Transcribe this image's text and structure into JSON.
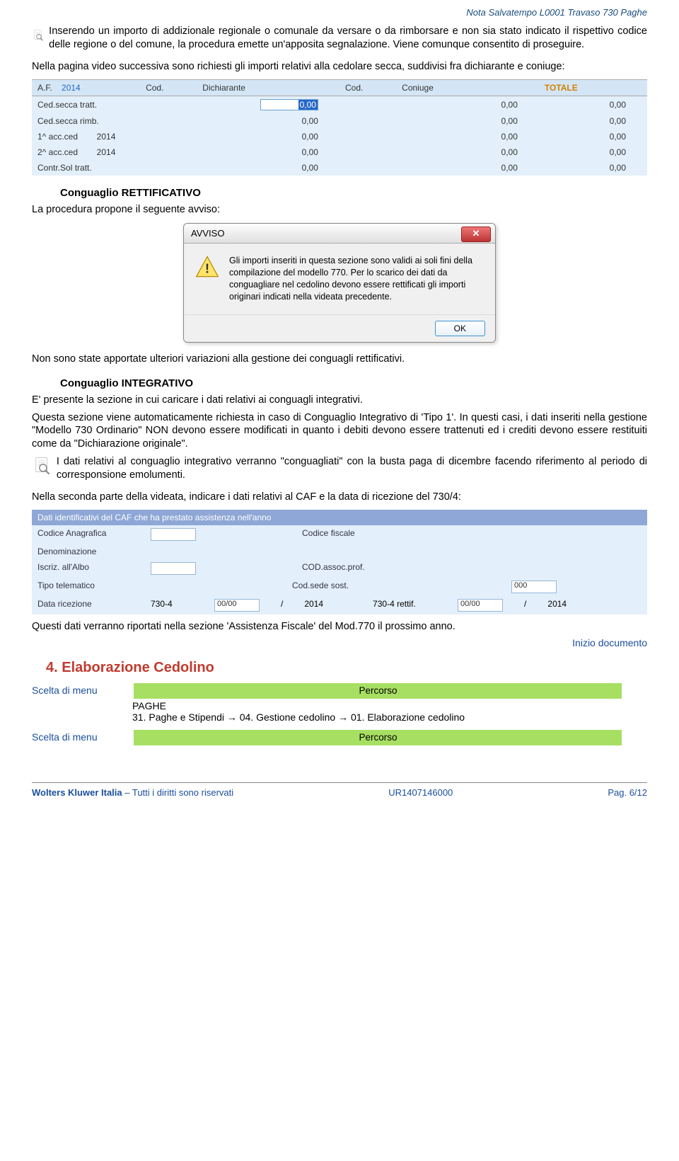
{
  "header": {
    "right": "Nota Salvatempo  L0001 Travaso 730 Paghe"
  },
  "para1": "Inserendo un importo di addizionale regionale o comunale da versare o da rimborsare e non sia stato indicato il rispettivo codice delle regione o del comune, la procedura emette un'apposita segnalazione. Viene comunque consentito di proseguire.",
  "para2": "Nella pagina video successiva sono richiesti gli importi relativi alla cedolare secca, suddivisi fra dichiarante e coniuge:",
  "table1": {
    "headers": [
      "A.F.",
      "2014",
      "",
      "Cod.",
      "Dichiarante",
      "",
      "Cod.",
      "Coniuge",
      "",
      "TOTALE"
    ],
    "rows": [
      {
        "label": "Ced.secca tratt.",
        "year": "",
        "d": "0,00",
        "c": "0,00",
        "t": "0,00",
        "hl": true
      },
      {
        "label": "Ced.secca rimb.",
        "year": "",
        "d": "0,00",
        "c": "0,00",
        "t": "0,00"
      },
      {
        "label": "1^ acc.ced",
        "year": "2014",
        "d": "0,00",
        "c": "0,00",
        "t": "0,00"
      },
      {
        "label": "2^ acc.ced",
        "year": "2014",
        "d": "0,00",
        "c": "0,00",
        "t": "0,00"
      },
      {
        "label": "Contr.Sol tratt.",
        "year": "",
        "d": "0,00",
        "c": "0,00",
        "t": "0,00"
      }
    ]
  },
  "sub1": "Conguaglio RETTIFICATIVO",
  "para3": "La procedura propone il seguente avviso:",
  "dialog": {
    "title": "AVVISO",
    "text": "Gli importi inseriti in questa sezione sono validi ai soli fini della compilazione del modello 770. Per lo scarico dei dati da conguagliare nel cedolino devono essere rettificati gli importi originari indicati nella videata precedente.",
    "ok": "OK"
  },
  "para4": "Non sono state apportate ulteriori variazioni alla gestione dei conguagli rettificativi.",
  "sub2": "Conguaglio INTEGRATIVO",
  "para5": "E' presente la sezione in cui caricare i dati relativi ai conguagli integrativi.",
  "para6": "Questa sezione viene automaticamente richiesta in caso di Conguaglio Integrativo di 'Tipo 1'. In questi casi, i dati inseriti nella gestione \"Modello 730 Ordinario\" NON devono essere modificati in quanto i debiti devono essere trattenuti ed i crediti devono essere restituiti come da \"Dichiarazione originale\".",
  "para7": "I dati relativi al conguaglio integrativo verranno \"conguagliati\" con la busta paga di dicembre facendo riferimento al periodo di corresponsione emolumenti.",
  "para8": "Nella seconda parte della videata, indicare i dati relativi al CAF e la data di ricezione del 730/4:",
  "caf": {
    "header": "Dati identificativi del CAF che ha prestato assistenza nell'anno",
    "codice_anag": "Codice Anagrafica",
    "codfisc": "Codice fiscale",
    "denom": "Denominazione",
    "iscr": "Iscriz. all'Albo",
    "codassoc": "COD.assoc.prof.",
    "tipotel": "Tipo telematico",
    "codsede": "Cod.sede sost.",
    "codsede_val": "000",
    "datariz": "Data ricezione",
    "r1": "730-4",
    "d1": "00/00",
    "y1": "2014",
    "r2": "730-4 rettif.",
    "d2": "00/00",
    "y2": "2014"
  },
  "para9": "Questi dati verranno riportati nella sezione 'Assistenza Fiscale' del Mod.770 il prossimo anno.",
  "link": "Inizio documento",
  "section": "4.  Elaborazione Cedolino",
  "menu_label": "Scelta di menu",
  "percorso": "Percorso",
  "paghe": "PAGHE",
  "path_text": "31. Paghe e Stipendi → 04. Gestione cedolino → 01. Elaborazione cedolino",
  "footer": {
    "company": "Wolters Kluwer Italia",
    "rights": " – Tutti i diritti sono riservati",
    "code": "UR1407146000",
    "page": "Pag.  6/12"
  }
}
